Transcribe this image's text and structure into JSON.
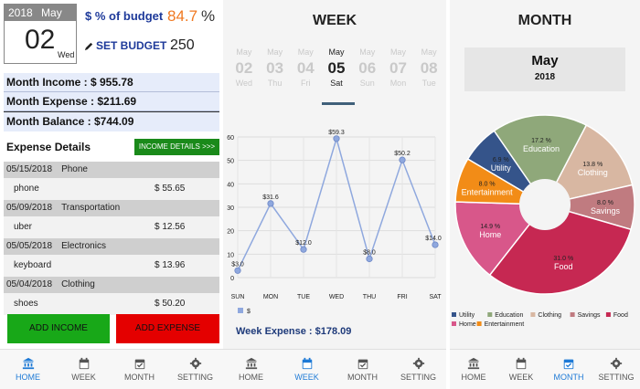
{
  "home": {
    "year": "2018",
    "month": "May",
    "day": "02",
    "weekday": "Wed",
    "budget_pct_label": "$ % of budget",
    "budget_pct_value": "84.7",
    "budget_pct_sign": "%",
    "set_budget_label": "SET BUDGET",
    "budget_value": "250",
    "month_income": "Month Income : $ 955.78",
    "month_expense": "Month Expense : $211.69",
    "month_balance": "Month Balance : $744.09",
    "expense_details_title": "Expense Details",
    "income_details_button": "INCOME DETAILS >>>",
    "expenses": [
      {
        "date": "05/15/2018",
        "category": "Phone",
        "item": "phone",
        "amount": "$  55.65"
      },
      {
        "date": "05/09/2018",
        "category": "Transportation",
        "item": "uber",
        "amount": "$  12.56"
      },
      {
        "date": "05/05/2018",
        "category": "Electronics",
        "item": "keyboard",
        "amount": "$  13.96"
      },
      {
        "date": "05/04/2018",
        "category": "Clothing",
        "item": "shoes",
        "amount": "$  50.20"
      }
    ],
    "add_income": "ADD INCOME",
    "add_expense": "ADD EXPENSE"
  },
  "week": {
    "title": "WEEK",
    "days": [
      {
        "month": "May",
        "num": "02",
        "wd": "Wed",
        "selected": false
      },
      {
        "month": "May",
        "num": "03",
        "wd": "Thu",
        "selected": false
      },
      {
        "month": "May",
        "num": "04",
        "wd": "Fri",
        "selected": false
      },
      {
        "month": "May",
        "num": "05",
        "wd": "Sat",
        "selected": true
      },
      {
        "month": "May",
        "num": "06",
        "wd": "Sun",
        "selected": false
      },
      {
        "month": "May",
        "num": "07",
        "wd": "Mon",
        "selected": false
      },
      {
        "month": "May",
        "num": "08",
        "wd": "Tue",
        "selected": false
      }
    ],
    "week_expense": "Week Expense : $178.09"
  },
  "month": {
    "title": "MONTH",
    "month_name": "May",
    "year": "2018"
  },
  "nav": [
    {
      "label": "HOME",
      "icon": "bank-icon"
    },
    {
      "label": "WEEK",
      "icon": "calendar-icon"
    },
    {
      "label": "MONTH",
      "icon": "calendar-check-icon"
    },
    {
      "label": "SETTING",
      "icon": "gear-icon"
    }
  ],
  "chart_data": [
    {
      "type": "line",
      "categories": [
        "SUN",
        "MON",
        "TUE",
        "WED",
        "THU",
        "FRI",
        "SAT"
      ],
      "series": [
        {
          "name": "$",
          "values": [
            3.0,
            31.6,
            12.0,
            59.3,
            8.0,
            50.2,
            14.0
          ]
        }
      ],
      "data_labels": [
        "$3.0",
        "$31.6",
        "$12.0",
        "$59.3",
        "$8.0",
        "$50.2",
        "$14.0"
      ],
      "ylim": [
        0,
        60
      ],
      "yticks": [
        0,
        10,
        20,
        30,
        40,
        50,
        60
      ],
      "grid": true,
      "legend": "bottom-left",
      "color": "#8fa8de"
    },
    {
      "type": "pie",
      "donut": true,
      "slices": [
        {
          "label": "Utility",
          "value": 6.9,
          "text": "6.9 %",
          "color": "#35548a"
        },
        {
          "label": "Education",
          "value": 17.2,
          "text": "17.2 %",
          "color": "#8fa87a"
        },
        {
          "label": "Clothing",
          "value": 13.8,
          "text": "13.8 %",
          "color": "#d8b7a2"
        },
        {
          "label": "Savings",
          "value": 8.0,
          "text": "8.0 %",
          "color": "#c07b80"
        },
        {
          "label": "Food",
          "value": 31.0,
          "text": "31.0 %",
          "color": "#c62852"
        },
        {
          "label": "Home",
          "value": 14.9,
          "text": "14.9 %",
          "color": "#d8578a"
        },
        {
          "label": "Entertainment",
          "value": 8.0,
          "text": "8.0 %",
          "color": "#f28c17"
        }
      ],
      "legend": "bottom"
    }
  ]
}
